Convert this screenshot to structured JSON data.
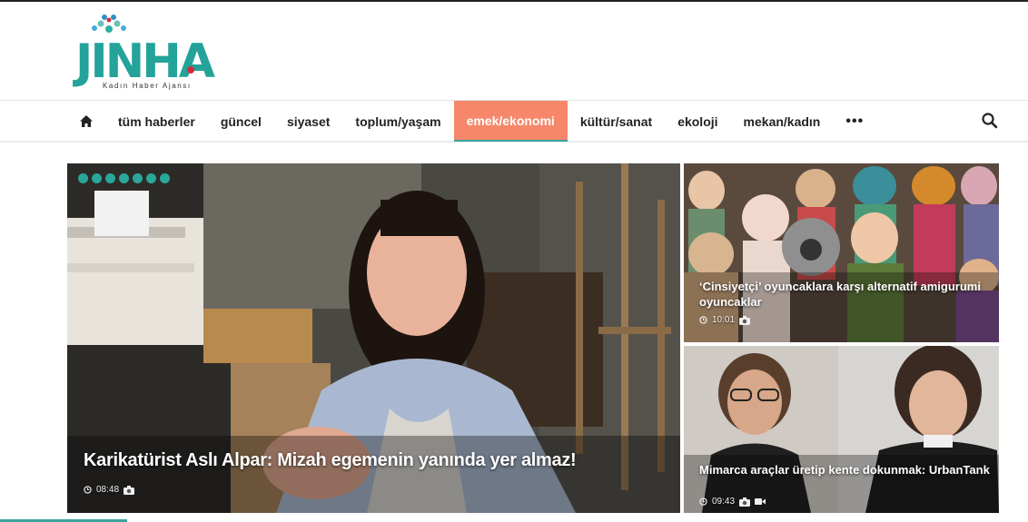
{
  "brand": {
    "name": "JINHA",
    "subtitle": "Kadın Haber Ajansı",
    "accent": "#23a39a",
    "highlight": "#f6876a",
    "logo_icon": "peacock-fan-icon"
  },
  "nav": {
    "home_icon": "home-icon",
    "items": [
      {
        "label": "tüm haberler"
      },
      {
        "label": "güncel"
      },
      {
        "label": "siyaset"
      },
      {
        "label": "toplum/yaşam"
      },
      {
        "label": "emek/ekonomi",
        "active": true
      },
      {
        "label": "kültür/sanat"
      },
      {
        "label": "ekoloji"
      },
      {
        "label": "mekan/kadın"
      }
    ],
    "more_label": "•••",
    "search_icon": "search-icon"
  },
  "featured": {
    "title": "Karikatürist Aslı Alpar: Mizah egemenin yanında yer almaz!",
    "time": "08:48",
    "icons": [
      "clock-icon",
      "camera-icon"
    ]
  },
  "side_stories": [
    {
      "title": "‘Cinsiyetçi’ oyuncaklara karşı alternatif amigurumi oyuncaklar",
      "time": "10:01",
      "icons": [
        "clock-icon",
        "camera-icon"
      ]
    },
    {
      "title": "Mimarca araçlar üretip kente dokunmak: UrbanTank",
      "time": "09:43",
      "icons": [
        "clock-icon",
        "camera-icon",
        "video-icon"
      ]
    }
  ]
}
